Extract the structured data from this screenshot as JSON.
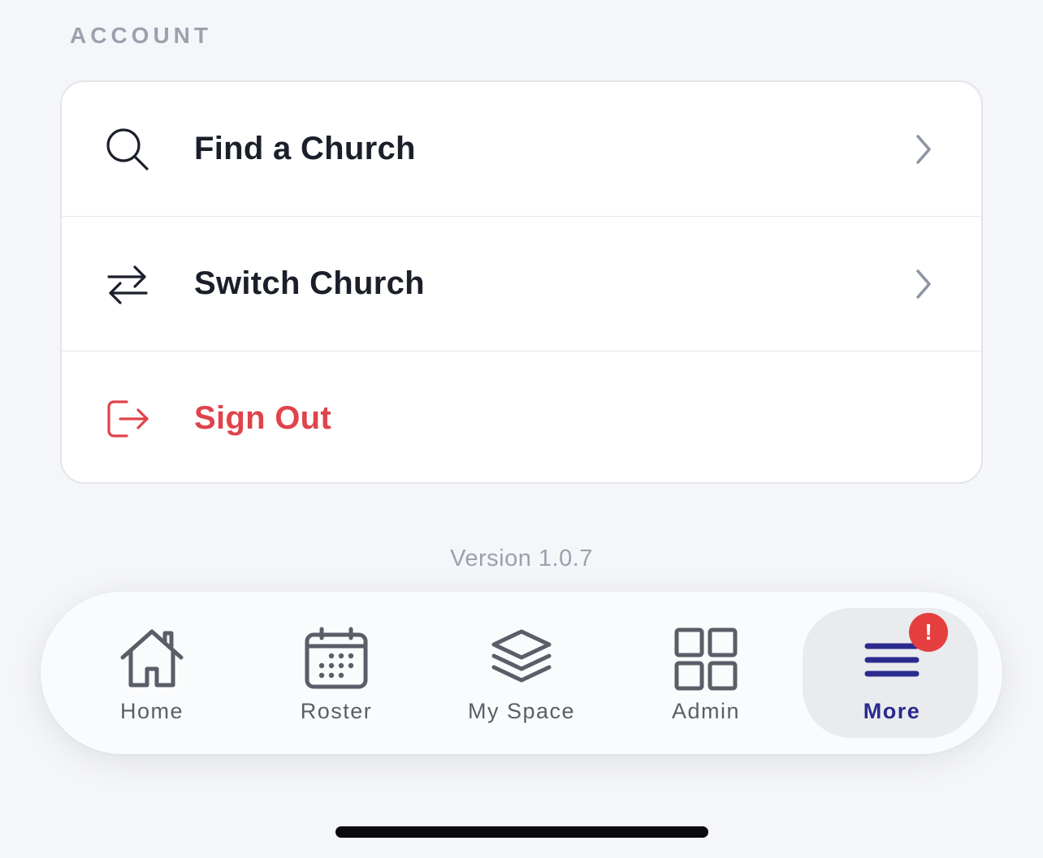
{
  "section": {
    "title": "ACCOUNT"
  },
  "account_items": [
    {
      "label": "Find a Church",
      "icon": "search-icon",
      "has_chevron": true
    },
    {
      "label": "Switch Church",
      "icon": "switch-arrows-icon",
      "has_chevron": true
    },
    {
      "label": "Sign Out",
      "icon": "sign-out-icon",
      "has_chevron": false,
      "color": "#e0434a"
    }
  ],
  "version": "Version 1.0.7",
  "tabbar": {
    "tabs": [
      {
        "label": "Home",
        "icon": "home-icon"
      },
      {
        "label": "Roster",
        "icon": "calendar-icon"
      },
      {
        "label": "My Space",
        "icon": "layers-icon"
      },
      {
        "label": "Admin",
        "icon": "grid-icon"
      },
      {
        "label": "More",
        "icon": "menu-icon",
        "active": true,
        "badge": "!"
      }
    ]
  },
  "colors": {
    "accent": "#2b2a8e",
    "danger": "#e0434a",
    "badge": "#e53e3e",
    "muted": "#9ba1ad"
  }
}
